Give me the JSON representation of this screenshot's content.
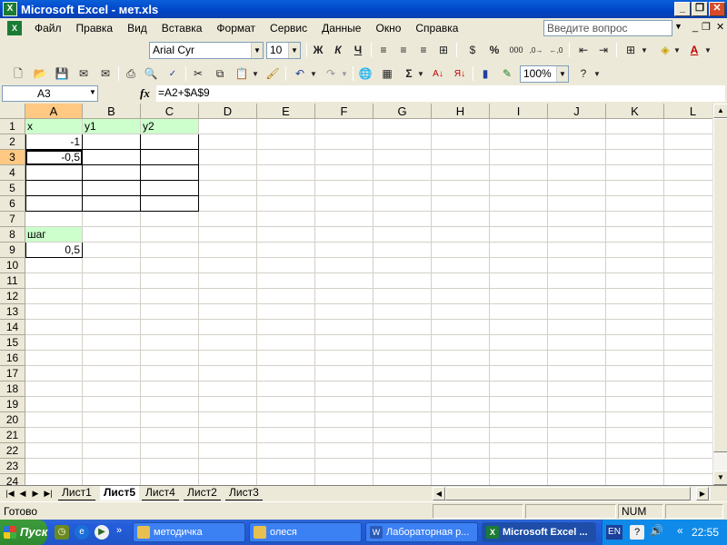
{
  "window": {
    "title": "Microsoft Excel - мет.xls"
  },
  "menu": {
    "items": [
      "Файл",
      "Правка",
      "Вид",
      "Вставка",
      "Формат",
      "Сервис",
      "Данные",
      "Окно",
      "Справка"
    ],
    "help_placeholder": "Введите вопрос"
  },
  "format_toolbar": {
    "font": "Arial Cyr",
    "size": "10"
  },
  "standard_toolbar": {
    "zoom": "100%"
  },
  "formula_bar": {
    "name_box": "A3",
    "fx": "fx",
    "formula": "=A2+$A$9"
  },
  "grid": {
    "columns": [
      "A",
      "B",
      "C",
      "D",
      "E",
      "F",
      "G",
      "H",
      "I",
      "J",
      "K",
      "L"
    ],
    "rows": [
      "1",
      "2",
      "3",
      "4",
      "5",
      "6",
      "7",
      "8",
      "9",
      "10",
      "11",
      "12",
      "13",
      "14",
      "15",
      "16",
      "17",
      "18",
      "19",
      "20",
      "21",
      "22",
      "23",
      "24"
    ],
    "active_cell": "A3",
    "cells": {
      "A1": "x",
      "B1": "y1",
      "C1": "y2",
      "A2": "-1",
      "A3": "-0,5",
      "A8": "шаг",
      "A9": "0,5"
    }
  },
  "sheets": {
    "tabs": [
      "Лист1",
      "Лист5",
      "Лист4",
      "Лист2",
      "Лист3"
    ],
    "active": "Лист5"
  },
  "status": {
    "left": "Готово",
    "num": "NUM"
  },
  "taskbar": {
    "start": "Пуск",
    "buttons": [
      "методичка",
      "олеся",
      "Лабораторная р...",
      "Microsoft Excel ..."
    ],
    "active": "Microsoft Excel ...",
    "lang": "EN",
    "clock": "22:55"
  },
  "colors": {
    "header_fill": "#ccffcc",
    "active_header": "#ffc883",
    "titlebar": "#0a5fd8"
  }
}
